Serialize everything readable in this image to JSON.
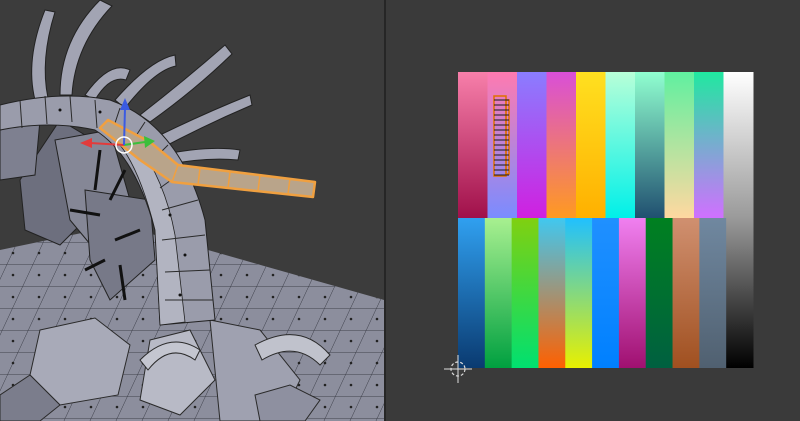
{
  "viewport_3d": {
    "panel": "3d-viewport",
    "selected_object": "highlighted-edge-loop",
    "colors": {
      "background": "#3c3c3c",
      "mesh_fill": "#9a9cab",
      "mesh_shadow": "#6f7180",
      "wire": "#2a2a2a",
      "selection": "#f0a040",
      "gizmo_x": "#e23b3b",
      "gizmo_y": "#3bbf3b",
      "gizmo_z": "#3b5be2"
    }
  },
  "uv_editor": {
    "panel": "uv-image-editor",
    "image": "color-grid-texture",
    "top_columns": [
      [
        "#f77faa",
        "#a0104a"
      ],
      [
        "#ff7ab0",
        "#7a8cff"
      ],
      [
        "#8a7dff",
        "#d020e0"
      ],
      [
        "#d94fd8",
        "#ff9a20"
      ],
      [
        "#ffe020",
        "#ffb000"
      ],
      [
        "#b8ffd8",
        "#00f0e8"
      ],
      [
        "#90ffd0",
        "#205070"
      ],
      [
        "#60f0a0",
        "#ffd8a0"
      ],
      [
        "#20e8a0",
        "#d070ff"
      ],
      [
        "#ffffff",
        "#9a9a9a"
      ]
    ],
    "bottom_columns": [
      [
        "#30a0f0",
        "#0a3a70"
      ],
      [
        "#a8f090",
        "#00a040"
      ],
      [
        "#80d010",
        "#00e070"
      ],
      [
        "#40c8f0",
        "#ff6000"
      ],
      [
        "#20c0ff",
        "#e8f000"
      ],
      [
        "#2090ff",
        "#0080ff"
      ],
      [
        "#f080f0",
        "#a01070"
      ],
      [
        "#008020",
        "#006040"
      ],
      [
        "#d09070",
        "#a05020"
      ],
      [
        "#7088a0",
        "#506070"
      ],
      [
        "#9a9a9a",
        "#000000"
      ]
    ],
    "uv_island_color": "#e07000",
    "cursor": "2d-cursor"
  }
}
